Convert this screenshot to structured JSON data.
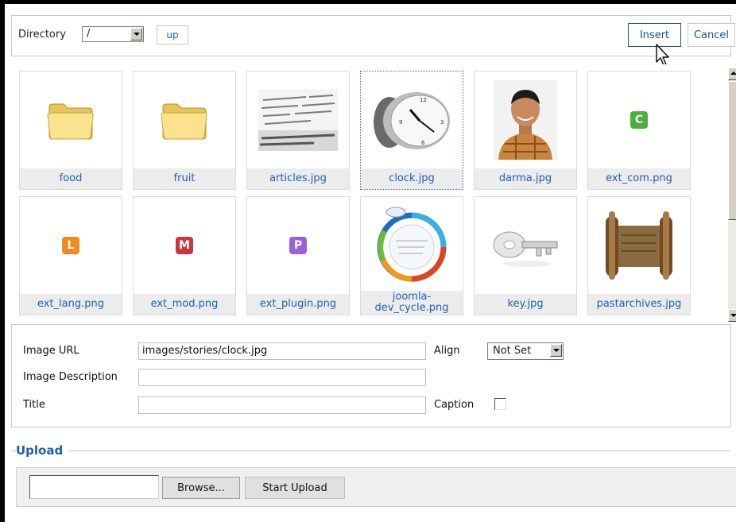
{
  "toolbar": {
    "directory_label": "Directory",
    "directory_value": "/",
    "up_label": "up",
    "insert_label": "Insert",
    "cancel_label": "Cancel"
  },
  "files": [
    {
      "name": "food",
      "kind": "folder"
    },
    {
      "name": "fruit",
      "kind": "folder"
    },
    {
      "name": "articles.jpg",
      "kind": "image-articles"
    },
    {
      "name": "clock.jpg",
      "kind": "image-clock",
      "selected": true
    },
    {
      "name": "darma.jpg",
      "kind": "image-person"
    },
    {
      "name": "ext_com.png",
      "kind": "badge",
      "letter": "C",
      "color": "#4caf3a"
    },
    {
      "name": "ext_lang.png",
      "kind": "badge",
      "letter": "L",
      "color": "#f08a24"
    },
    {
      "name": "ext_mod.png",
      "kind": "badge",
      "letter": "M",
      "color": "#c8383a"
    },
    {
      "name": "ext_plugin.png",
      "kind": "badge",
      "letter": "P",
      "color": "#9b5fd6"
    },
    {
      "name": "joomla-\ndev_cycle.png",
      "kind": "image-cycle"
    },
    {
      "name": "key.jpg",
      "kind": "image-key"
    },
    {
      "name": "pastarchives.jpg",
      "kind": "image-scroll"
    }
  ],
  "properties": {
    "image_url_label": "Image URL",
    "image_url_value": "images/stories/clock.jpg",
    "description_label": "Image Description",
    "description_value": "",
    "title_label": "Title",
    "title_value": "",
    "align_label": "Align",
    "align_value": "Not Set",
    "caption_label": "Caption",
    "caption_checked": false
  },
  "upload": {
    "legend": "Upload",
    "browse_label": "Browse...",
    "start_label": "Start Upload"
  },
  "colors": {
    "link_blue": "#1a5fb4",
    "tile_label_bg": "#ececec"
  }
}
